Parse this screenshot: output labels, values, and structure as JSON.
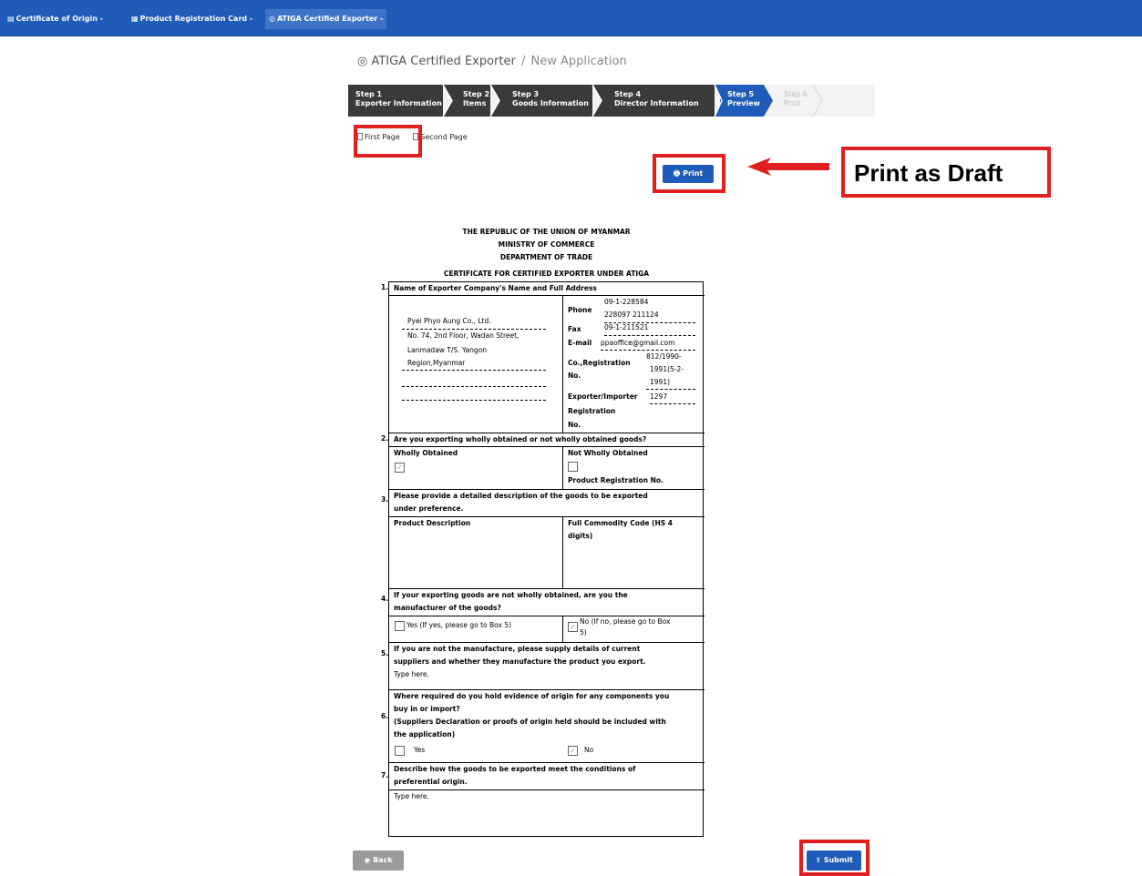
{
  "nav": {
    "items": [
      {
        "icon": "certificate-icon",
        "label": "Certificate of Origin -"
      },
      {
        "icon": "product-card-icon",
        "label": "Product Registration Card -"
      },
      {
        "icon": "exporter-icon",
        "label": "ATIGA Certified Exporter -"
      }
    ]
  },
  "breadcrumb": {
    "icon": "exporter-icon",
    "section": "ATIGA Certified Exporter",
    "separator": "/",
    "page": "New Application"
  },
  "steps": [
    {
      "step": "Step 1",
      "label": "Exporter Information"
    },
    {
      "step": "Step 2",
      "label": "Items"
    },
    {
      "step": "Step 3",
      "label": "Goods Information"
    },
    {
      "step": "Step 4",
      "label": "Director Information"
    },
    {
      "step": "Step 5",
      "label": "Preview"
    },
    {
      "step": "Step 6",
      "label": "Print"
    }
  ],
  "pagetabs": {
    "first": "First Page",
    "second": "Second Page"
  },
  "buttons": {
    "print": "Print",
    "back": "Back",
    "submit": "Submit"
  },
  "annotation": {
    "text": "Print as Draft"
  },
  "certificate": {
    "header": [
      "THE REPUBLIC OF THE UNION OF MYANMAR",
      "MINISTRY OF COMMERCE",
      "DEPARTMENT OF TRADE",
      "CERTIFICATE FOR CERTIFIED EXPORTER UNDER ATIGA"
    ],
    "q1": {
      "num": "1.",
      "title": "Name of Exporter Company's Name and Full Address",
      "address": [
        "Pyei Phyo Aung Co., Ltd.",
        "No. 74, 2nd Floor, Wadan Street,",
        "Lanmadaw T/S. Yangon",
        "Region,Myanmar"
      ],
      "phone_label": "Phone",
      "phone": [
        "09-1-228584",
        "228097 211124"
      ],
      "fax_label": "Fax",
      "fax": "09-1-211521",
      "email_label": "E-mail",
      "email": "ppaoffice@gmail.com",
      "coreg_label": [
        "Co.,Registration",
        "No."
      ],
      "coreg": [
        "812/1990-",
        "1991(5-2-",
        "1991)"
      ],
      "expreg_label": [
        "Exporter/Importer",
        "Registration",
        "No."
      ],
      "expreg": "1297"
    },
    "q2": {
      "num": "2.",
      "title": "Are you exporting wholly obtained or not wholly obtained goods?",
      "wholly": "Wholly Obtained",
      "not_wholly": "Not Wholly Obtained",
      "prn": "Product Registration No."
    },
    "q3": {
      "num": "3.",
      "title": [
        "Please provide a detailed description of the goods to be exported",
        "under preference."
      ],
      "col1": "Product Description",
      "col2": [
        "Full Commodity Code (HS 4",
        "digits)"
      ]
    },
    "q4": {
      "num": "4.",
      "title": [
        "If your exporting goods are not wholly obtained, are you the",
        "manufacturer of the goods?"
      ],
      "yes": "Yes (If yes, please go to Box 5)",
      "no": [
        "No (If no, please go to Box",
        "5)"
      ]
    },
    "q5": {
      "num": "5.",
      "title": [
        "If you are not the manufacture, please supply details of current",
        "suppliers and whether they manufacture the product you export."
      ],
      "value": "Type here."
    },
    "q6": {
      "num": "6.",
      "title": [
        "Where required do you hold evidence of origin for any components you",
        "buy in or import?",
        "(Suppliers Declaration or proofs of origin held should be included with",
        "the application)"
      ],
      "yes": "Yes",
      "no": "No"
    },
    "q7": {
      "num": "7.",
      "title": [
        "Describe how the goods to be exported meet the conditions of",
        "preferential origin."
      ],
      "value": "Type here."
    }
  }
}
